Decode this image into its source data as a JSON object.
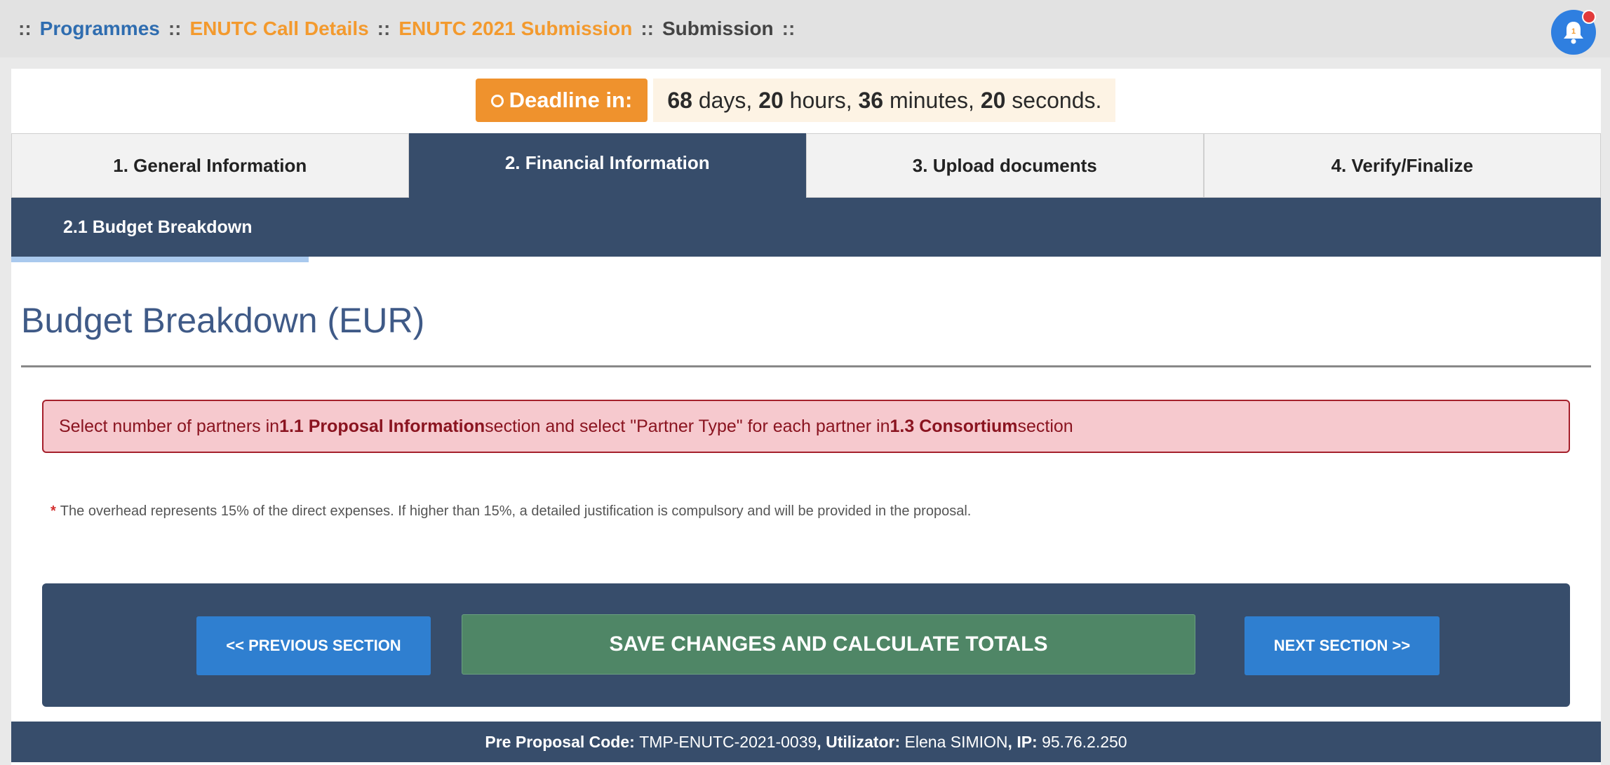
{
  "breadcrumb": {
    "separator": "::",
    "programmes": "Programmes",
    "call_details": "ENUTC Call Details",
    "submission_parent": "ENUTC 2021 Submission",
    "current": "Submission"
  },
  "notifications": {
    "count": "1"
  },
  "deadline": {
    "label": "Deadline in:",
    "days": "68",
    "days_unit": "days,",
    "hours": "20",
    "hours_unit": "hours,",
    "minutes": "36",
    "minutes_unit": "minutes,",
    "seconds": "20",
    "seconds_unit": "seconds."
  },
  "tabs": [
    {
      "label": "1. General Information"
    },
    {
      "label": "2. Financial Information"
    },
    {
      "label": "3. Upload documents"
    },
    {
      "label": "4. Verify/Finalize"
    }
  ],
  "subtab": {
    "label": "2.1 Budget Breakdown"
  },
  "page_title": "Budget Breakdown (EUR)",
  "alert": {
    "part1": "Select number of partners in ",
    "bold1": "1.1 Proposal Information",
    "part2": " section and select \"Partner Type\" for each partner in ",
    "bold2": "1.3 Consortium",
    "part3": " section"
  },
  "note": {
    "star": "*",
    "text": "The overhead represents 15% of the direct expenses. If higher than 15%, a detailed justification is compulsory and will be provided in the proposal."
  },
  "actions": {
    "prev": "<< PREVIOUS SECTION",
    "save": "SAVE CHANGES AND CALCULATE TOTALS",
    "next": "NEXT SECTION >>"
  },
  "footer": {
    "code_label": "Pre Proposal Code:",
    "code_value": "TMP-ENUTC-2021-0039",
    "user_label": "Utilizator:",
    "user_value": "Elena SIMION",
    "ip_label": "IP:",
    "ip_value": "95.76.2.250"
  },
  "colors": {
    "navy": "#374d6b",
    "accent_orange": "#ef922d",
    "button_blue": "#2f7fd0",
    "save_green": "#4f8666",
    "alert_bg": "#f6c9ce"
  }
}
